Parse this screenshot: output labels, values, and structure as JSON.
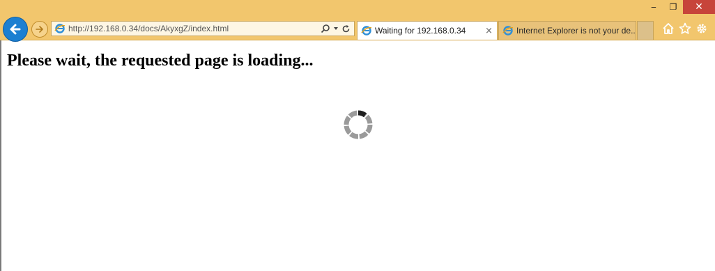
{
  "browser": {
    "address_url": "http://192.168.0.34/docs/AkyxgZ/index.html",
    "tabs": [
      {
        "label": "Waiting for 192.168.0.34",
        "active": true,
        "close": "×"
      },
      {
        "label": "Internet Explorer is not your de...",
        "active": false
      }
    ],
    "window_controls": {
      "minimize": "‒",
      "restore": "❐",
      "close": "✕"
    },
    "accent_color": "#f2c66d",
    "icons": [
      "back-arrow-icon",
      "forward-arrow-icon",
      "ie-icon",
      "search-icon",
      "refresh-icon",
      "home-icon",
      "star-icon",
      "gear-icon"
    ]
  },
  "page": {
    "heading": "Please wait, the requested page is loading...",
    "spinner": "loading-spinner-icon"
  }
}
